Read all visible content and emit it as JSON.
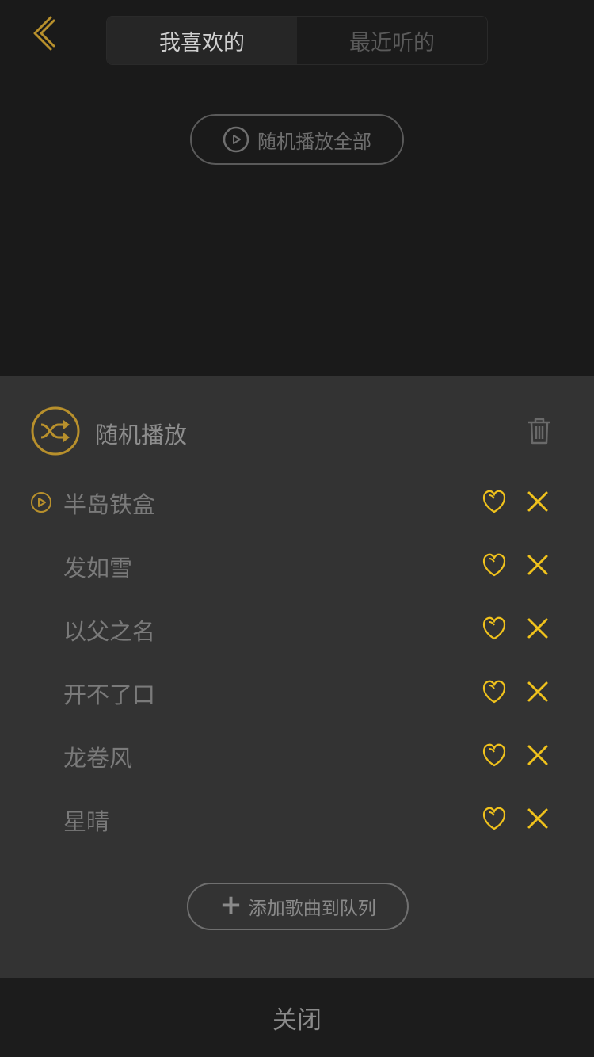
{
  "header": {
    "tabs": [
      {
        "label": "我喜欢的",
        "active": true
      },
      {
        "label": "最近听的",
        "active": false
      }
    ],
    "back_icon": "chevron-left-icon"
  },
  "shuffle_all": {
    "label": "随机播放全部",
    "icon": "play-circle-icon"
  },
  "queue": {
    "mode_label": "随机播放",
    "mode_icon": "shuffle-icon",
    "clear_icon": "trash-icon",
    "songs": [
      {
        "title": "半岛铁盒",
        "playing": true
      },
      {
        "title": "发如雪",
        "playing": false
      },
      {
        "title": "以父之名",
        "playing": false
      },
      {
        "title": "开不了口",
        "playing": false
      },
      {
        "title": "龙卷风",
        "playing": false
      },
      {
        "title": "星晴",
        "playing": false
      }
    ],
    "add_label": "添加歌曲到队列"
  },
  "footer": {
    "close_label": "关闭"
  },
  "colors": {
    "accent_gold": "#b8902c",
    "accent_yellow": "#f0c21c",
    "background": "#1a1a1a",
    "sheet": "#333333"
  }
}
